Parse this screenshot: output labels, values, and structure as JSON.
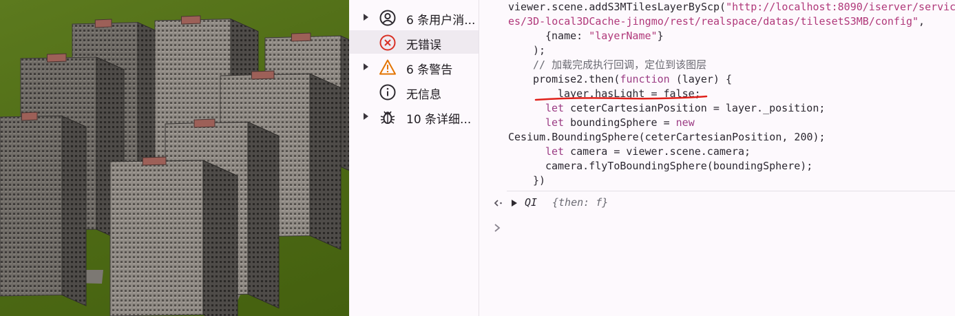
{
  "sidebar": {
    "items": [
      {
        "label": "6 条用户消...",
        "icon": "user-circle-icon",
        "expandable": true,
        "selected": false
      },
      {
        "label": "无错误",
        "icon": "error-circle-icon",
        "expandable": false,
        "selected": true
      },
      {
        "label": "6 条警告",
        "icon": "warning-triangle-icon",
        "expandable": true,
        "selected": false
      },
      {
        "label": "无信息",
        "icon": "info-circle-icon",
        "expandable": false,
        "selected": false
      },
      {
        "label": "10 条详细...",
        "icon": "bug-icon",
        "expandable": true,
        "selected": false
      }
    ]
  },
  "code": {
    "l1a": "viewer.scene.addS3MTilesLayerByScp(",
    "l1b": "\"http://localhost:8090/iserver/servic",
    "l2a": "es/3D-local3DCache-jingmo/rest/realspace/datas/tilesetS3MB/config\"",
    "l2b": ",",
    "l3a": "{name: ",
    "l3b": "\"layerName\"",
    "l3c": "}",
    "l4": ");",
    "l5": "// 加载完成执行回调，定位到该图层",
    "l6a": "promise2.then(",
    "l6b": "function",
    "l6c": " (layer) {",
    "l7": "layer.hasLight = false;",
    "l8a": "let",
    "l8b": " ceterCartesianPosition = layer._position;",
    "l9a": "let",
    "l9b": " boundingSphere = ",
    "l9c": "new",
    "l10a": "Cesium.BoundingSphere(ceterCartesianPosition, ",
    "l10b": "200",
    "l10c": ");",
    "l11a": "let",
    "l11b": " camera = viewer.scene.camera;",
    "l12": "camera.flyToBoundingSphere(boundingSphere);",
    "l13": "})"
  },
  "result": {
    "name": "QI",
    "preview": "{then: f}"
  },
  "colors": {
    "string": "#b0387a",
    "keyword": "#9b3c84",
    "comment": "#6a6a72",
    "error": "#d93025",
    "warning": "#e37400",
    "annotation_underline": "#e0201a"
  }
}
